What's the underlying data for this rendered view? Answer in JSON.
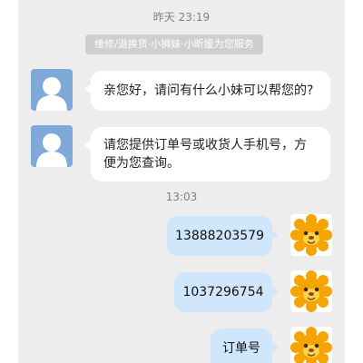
{
  "chat": {
    "timestamps": [
      "昨天 23:19",
      "13:03"
    ],
    "system_notice": "维修/退换货·小狮妹·小昕媛为您服务",
    "incoming": [
      {
        "text": "亲您好，请问有什么小妹可以帮您的?",
        "avatar": "default-user-avatar-icon"
      },
      {
        "text": "请您提供订单号或收货人手机号，方便为您查询。",
        "avatar": "default-user-avatar-icon"
      }
    ],
    "outgoing": [
      {
        "text": "13888203579",
        "avatar": "lion-mascot-avatar-icon"
      },
      {
        "text": "1037296754",
        "avatar": "lion-mascot-avatar-icon"
      },
      {
        "text": "订单号",
        "avatar": "lion-mascot-avatar-icon"
      }
    ]
  },
  "colors": {
    "chat_background": "#ededed",
    "incoming_bubble": "#ffffff",
    "outgoing_bubble": "#cfe6fb",
    "system_notice_bg": "#cfcfcf",
    "timestamp_text": "#808080",
    "mascot_orange": "#f6a400"
  }
}
